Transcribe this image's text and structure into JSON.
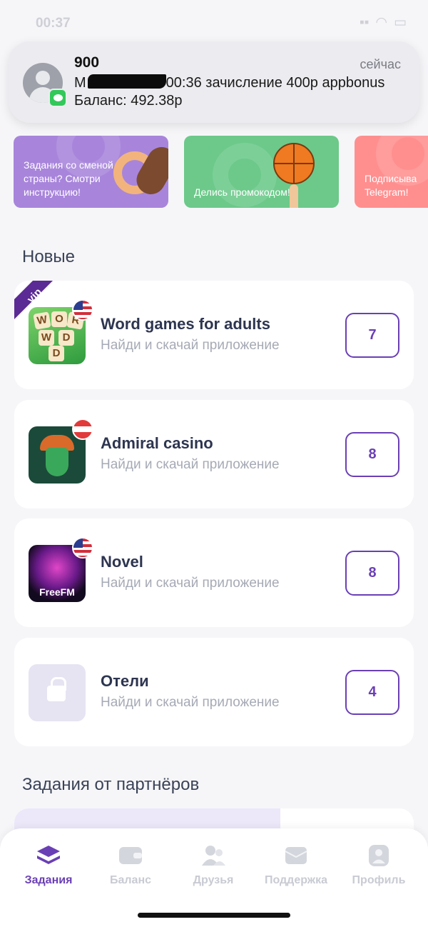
{
  "status_bar": {
    "time": "00:37"
  },
  "notification": {
    "sender": "900",
    "time": "сейчас",
    "line1_prefix": "M",
    "line1_suffix": "00:36 зачисление 400р appbonus",
    "line2": "Баланс: 492.38р"
  },
  "banners": [
    {
      "text": "Задания со сменой страны? Смотри инструкцию!",
      "color": "#a885db"
    },
    {
      "text": "Делись промокодом!",
      "color": "#6cc98a"
    },
    {
      "text": "Подписыва Telegram!",
      "color": "#ff8f8f"
    }
  ],
  "sections": {
    "new": "Новые",
    "partners": "Задания от партнёров"
  },
  "tasks": [
    {
      "name": "Word games for adults",
      "subtitle": "Найди и скачай приложение",
      "reward": "7",
      "badge": "vip",
      "flag": "us-flag-icon"
    },
    {
      "name": "Admiral casino",
      "subtitle": "Найди и скачай приложение",
      "reward": "8",
      "flag": "austria-flag-icon"
    },
    {
      "name": "Novel",
      "subtitle": "Найди и скачай приложение",
      "reward": "8",
      "flag": "us-flag-icon",
      "icon_text": "FreeFM"
    },
    {
      "name": "Отели",
      "subtitle": "Найди и скачай приложение",
      "reward": "4"
    }
  ],
  "word_tiles": [
    "W",
    "O",
    "R",
    "W",
    "D",
    "D"
  ],
  "tabbar": {
    "items": [
      {
        "label": "Задания",
        "icon": "layers-icon",
        "active": true
      },
      {
        "label": "Баланс",
        "icon": "wallet-icon",
        "active": false
      },
      {
        "label": "Друзья",
        "icon": "friends-icon",
        "active": false
      },
      {
        "label": "Поддержка",
        "icon": "mail-icon",
        "active": false
      },
      {
        "label": "Профиль",
        "icon": "profile-icon",
        "active": false
      }
    ]
  },
  "colors": {
    "accent": "#6a3fb5",
    "background": "#f6f6f9",
    "muted": "#a6aab5"
  }
}
